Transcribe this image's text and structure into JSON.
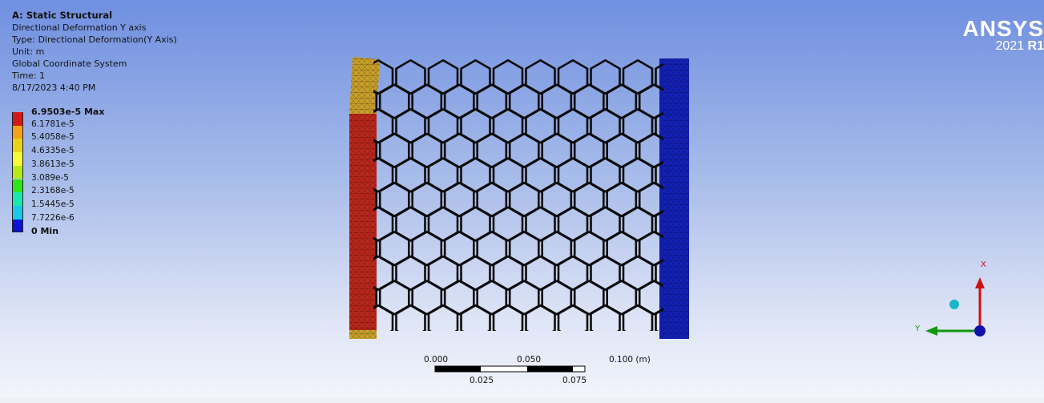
{
  "info": {
    "title": "A: Static Structural",
    "result_name": "Directional Deformation Y axis",
    "type": "Type: Directional Deformation(Y Axis)",
    "unit": "Unit: m",
    "coordinate_system": "Global Coordinate System",
    "time": "Time: 1",
    "date": "8/17/2023 4:40 PM"
  },
  "legend": {
    "entries": [
      {
        "label": "6.9503e-5 Max",
        "color": "#d11a1a"
      },
      {
        "label": "6.1781e-5",
        "color": "#f4a21a"
      },
      {
        "label": "5.4058e-5",
        "color": "#e8d21a"
      },
      {
        "label": "4.6335e-5",
        "color": "#f6f83a"
      },
      {
        "label": "3.8613e-5",
        "color": "#b5ea1a"
      },
      {
        "label": "3.089e-5",
        "color": "#2ee61a"
      },
      {
        "label": "2.3168e-5",
        "color": "#1ae8b0"
      },
      {
        "label": "1.5445e-5",
        "color": "#1ac8e8"
      },
      {
        "label": "7.7226e-6",
        "color": "#1a7ae8"
      },
      {
        "label": "0 Min",
        "color": "#0a14d4"
      }
    ]
  },
  "logo": {
    "brand": "ANSYS",
    "version_year": "2021",
    "version_release": "R1"
  },
  "scale_bar": {
    "top_labels": [
      "0.000",
      "0.050",
      "0.100 (m)"
    ],
    "bottom_labels": [
      "0.025",
      "0.075"
    ]
  },
  "triad": {
    "x_label": "X",
    "y_label": "Y"
  }
}
